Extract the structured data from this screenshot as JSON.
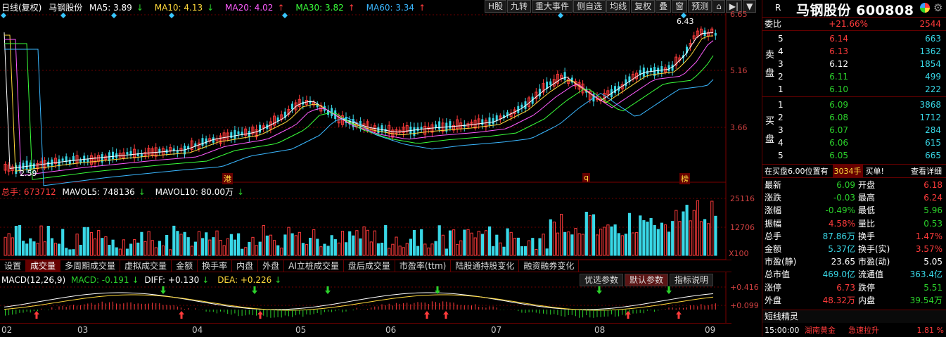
{
  "window": {
    "title": "日线(复权)",
    "stock_short": "马钢股份"
  },
  "ma_legend": [
    {
      "label": "MA5: 3.89",
      "arrow": "↓",
      "color": "#ffffff"
    },
    {
      "label": "MA10: 4.13",
      "arrow": "↓",
      "color": "#ffd93b"
    },
    {
      "label": "MA20: 4.02",
      "arrow": "↑",
      "color": "#ff5cff"
    },
    {
      "label": "MA30: 3.82",
      "arrow": "↑",
      "color": "#3aff3a"
    },
    {
      "label": "MA60: 3.34",
      "arrow": "↑",
      "color": "#3ab7ff"
    }
  ],
  "toolbar": [
    "H股",
    "九转",
    "重大事件",
    "侧自选",
    "均线",
    "复权",
    "叠",
    "窗",
    "预测"
  ],
  "price_axis": [
    "6.65",
    "5.16",
    "3.66"
  ],
  "price_marks": {
    "high": "6.43",
    "low": "2.59"
  },
  "event_marks": [
    "港",
    "q",
    "榜"
  ],
  "volume": {
    "total": "总手: 673712",
    "mavol5": "MAVOL5: 748136",
    "mavol10": "MAVOL10: 80.00万",
    "axis": [
      "25116",
      "12706",
      "X100"
    ]
  },
  "tabs": [
    "设置",
    "成交量",
    "多周期成交量",
    "虚拟成交量",
    "金额",
    "换手率",
    "内盘",
    "外盘",
    "AI立桩成交量",
    "盘后成交量",
    "市盈率(ttm)",
    "陆股通持股变化",
    "融资融券变化"
  ],
  "active_tab": "成交量",
  "macd": {
    "title": "MACD(12,26,9)",
    "macd": "MACD: -0.191",
    "diff": "DIFF: +0.130",
    "dea": "DEA: +0.226",
    "axis": [
      "+0.416",
      "+0.099"
    ]
  },
  "macd_buttons": [
    "优选参数",
    "默认参数",
    "指标说明"
  ],
  "x_axis": [
    "02",
    "03",
    "04",
    "05",
    "06",
    "07",
    "08",
    "09"
  ],
  "panel": {
    "r_label": "R",
    "name": "马钢股份 600808",
    "weibi": {
      "label": "委比",
      "pct": "+21.66%",
      "val": "2544"
    },
    "sell_label": "卖盘",
    "buy_label": "买盘",
    "sell": [
      [
        "5",
        "6.14",
        "663"
      ],
      [
        "4",
        "6.13",
        "1362"
      ],
      [
        "3",
        "6.12",
        "1854"
      ],
      [
        "2",
        "6.11",
        "499"
      ],
      [
        "1",
        "6.10",
        "222"
      ]
    ],
    "buy": [
      [
        "1",
        "6.09",
        "3868"
      ],
      [
        "2",
        "6.08",
        "1712"
      ],
      [
        "3",
        "6.07",
        "284"
      ],
      [
        "4",
        "6.06",
        "615"
      ],
      [
        "5",
        "6.05",
        "665"
      ]
    ],
    "notice": {
      "text": "在买盘6.00位置有",
      "qty": "3034手",
      "tag": "买单!",
      "link": "查看详细"
    },
    "stats": [
      [
        "最新",
        "6.09",
        "开盘",
        "6.18"
      ],
      [
        "涨跌",
        "-0.03",
        "最高",
        "6.24"
      ],
      [
        "涨幅",
        "-0.49%",
        "最低",
        "5.96"
      ],
      [
        "振幅",
        "4.58%",
        "量比",
        "0.53"
      ],
      [
        "总手",
        "87.86万",
        "换手",
        "1.47%"
      ],
      [
        "金额",
        "5.37亿",
        "换手(实)",
        "3.57%"
      ],
      [
        "市盈(静)",
        "23.65",
        "市盈(动)",
        "5.05"
      ],
      [
        "总市值",
        "469.0亿",
        "流通值",
        "363.4亿"
      ],
      [
        "涨停",
        "6.73",
        "跌停",
        "5.51"
      ],
      [
        "外盘",
        "48.32万",
        "内盘",
        "39.54万"
      ]
    ],
    "short_title": "短线精灵",
    "short_row": {
      "time": "15:00:00",
      "name": "湖南黄金",
      "event": "急速拉升",
      "pct": "1.81 %"
    }
  }
}
